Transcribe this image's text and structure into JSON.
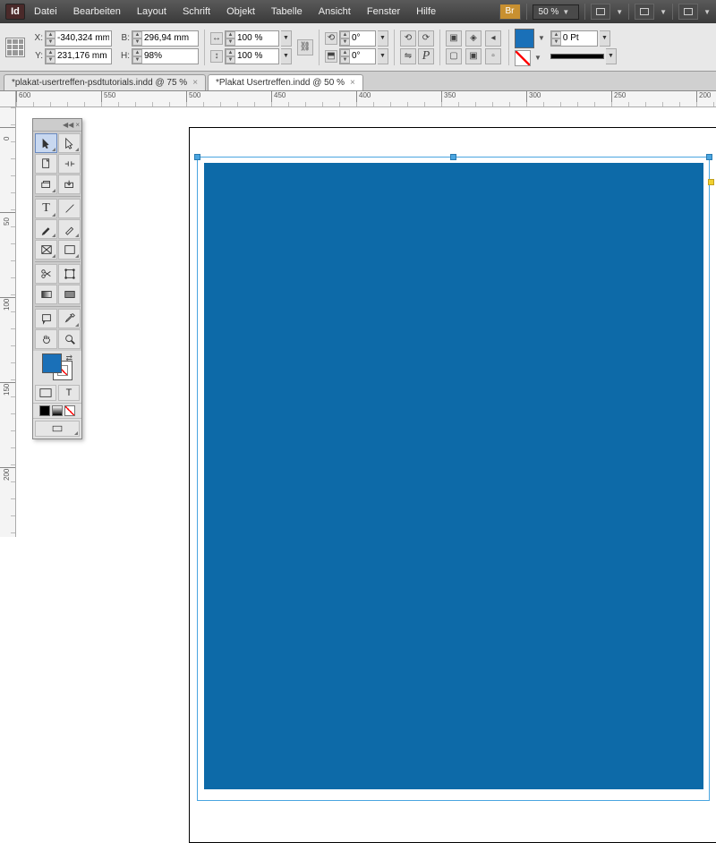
{
  "app": {
    "logo": "Id"
  },
  "menu": [
    "Datei",
    "Bearbeiten",
    "Layout",
    "Schrift",
    "Objekt",
    "Tabelle",
    "Ansicht",
    "Fenster",
    "Hilfe"
  ],
  "bridge_label": "Br",
  "zoom": "50 %",
  "transform": {
    "x_label": "X:",
    "x": "-340,324 mm",
    "y_label": "Y:",
    "y": "231,176 mm",
    "w_label": "B:",
    "w": "296,94 mm",
    "h_label": "H:",
    "h": "98%",
    "scale_x": "100 %",
    "scale_y": "100 %",
    "rotate": "0°",
    "shear": "0°",
    "stroke_weight": "0 Pt"
  },
  "tabs": [
    {
      "title": "*plakat-usertreffen-psdtutorials.indd @ 75 %",
      "active": false
    },
    {
      "title": "*Plakat Usertreffen.indd @ 50 %",
      "active": true
    }
  ],
  "ruler_h": [
    "600",
    "550",
    "500",
    "450",
    "400",
    "350",
    "300",
    "250",
    "200"
  ],
  "ruler_v": [
    "0",
    "50",
    "100",
    "150",
    "200"
  ],
  "colors": {
    "accent": "#1a70b8"
  }
}
